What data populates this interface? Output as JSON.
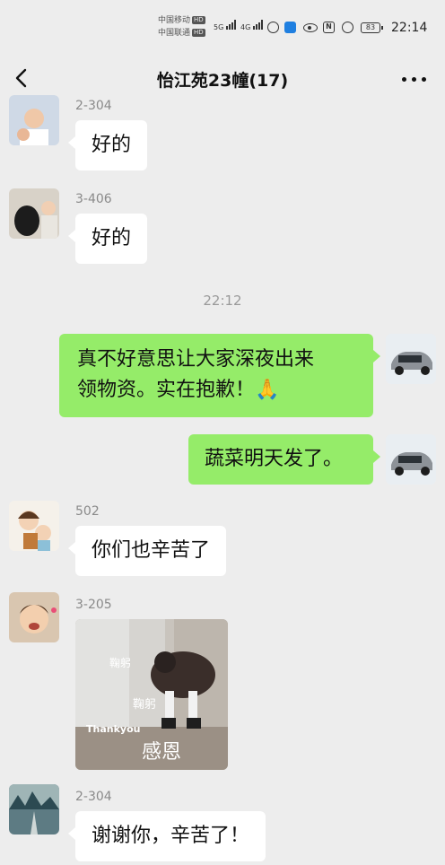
{
  "status_bar": {
    "carrier_1": "中国移动",
    "carrier_2": "中国联通",
    "hd": "HD",
    "signal_1_label": "5G",
    "signal_2_label": "4G",
    "battery_level": "83",
    "time": "22:14"
  },
  "header": {
    "title": "怡江苑23幢(17)"
  },
  "messages": [
    {
      "sender": "2-304",
      "text": "好的"
    },
    {
      "sender": "3-406",
      "text": "好的"
    },
    {
      "timestamp": "22:12"
    },
    {
      "text_line1": "真不好意思让大家深夜出来",
      "text_line2": "领物资。实在抱歉！🙏"
    },
    {
      "text": "蔬菜明天发了。"
    },
    {
      "sender": "502",
      "text": "你们也辛苦了"
    },
    {
      "sender": "3-205",
      "sticker": {
        "caption_small_1": "鞠躬",
        "caption_small_2": "鞠躬",
        "caption_en": "Thankyou",
        "caption_zh": "感恩"
      }
    },
    {
      "sender": "2-304",
      "text": "谢谢你，辛苦了！"
    }
  ],
  "colors": {
    "background": "#ededed",
    "self_bubble": "#95ec69",
    "other_bubble": "#ffffff"
  }
}
